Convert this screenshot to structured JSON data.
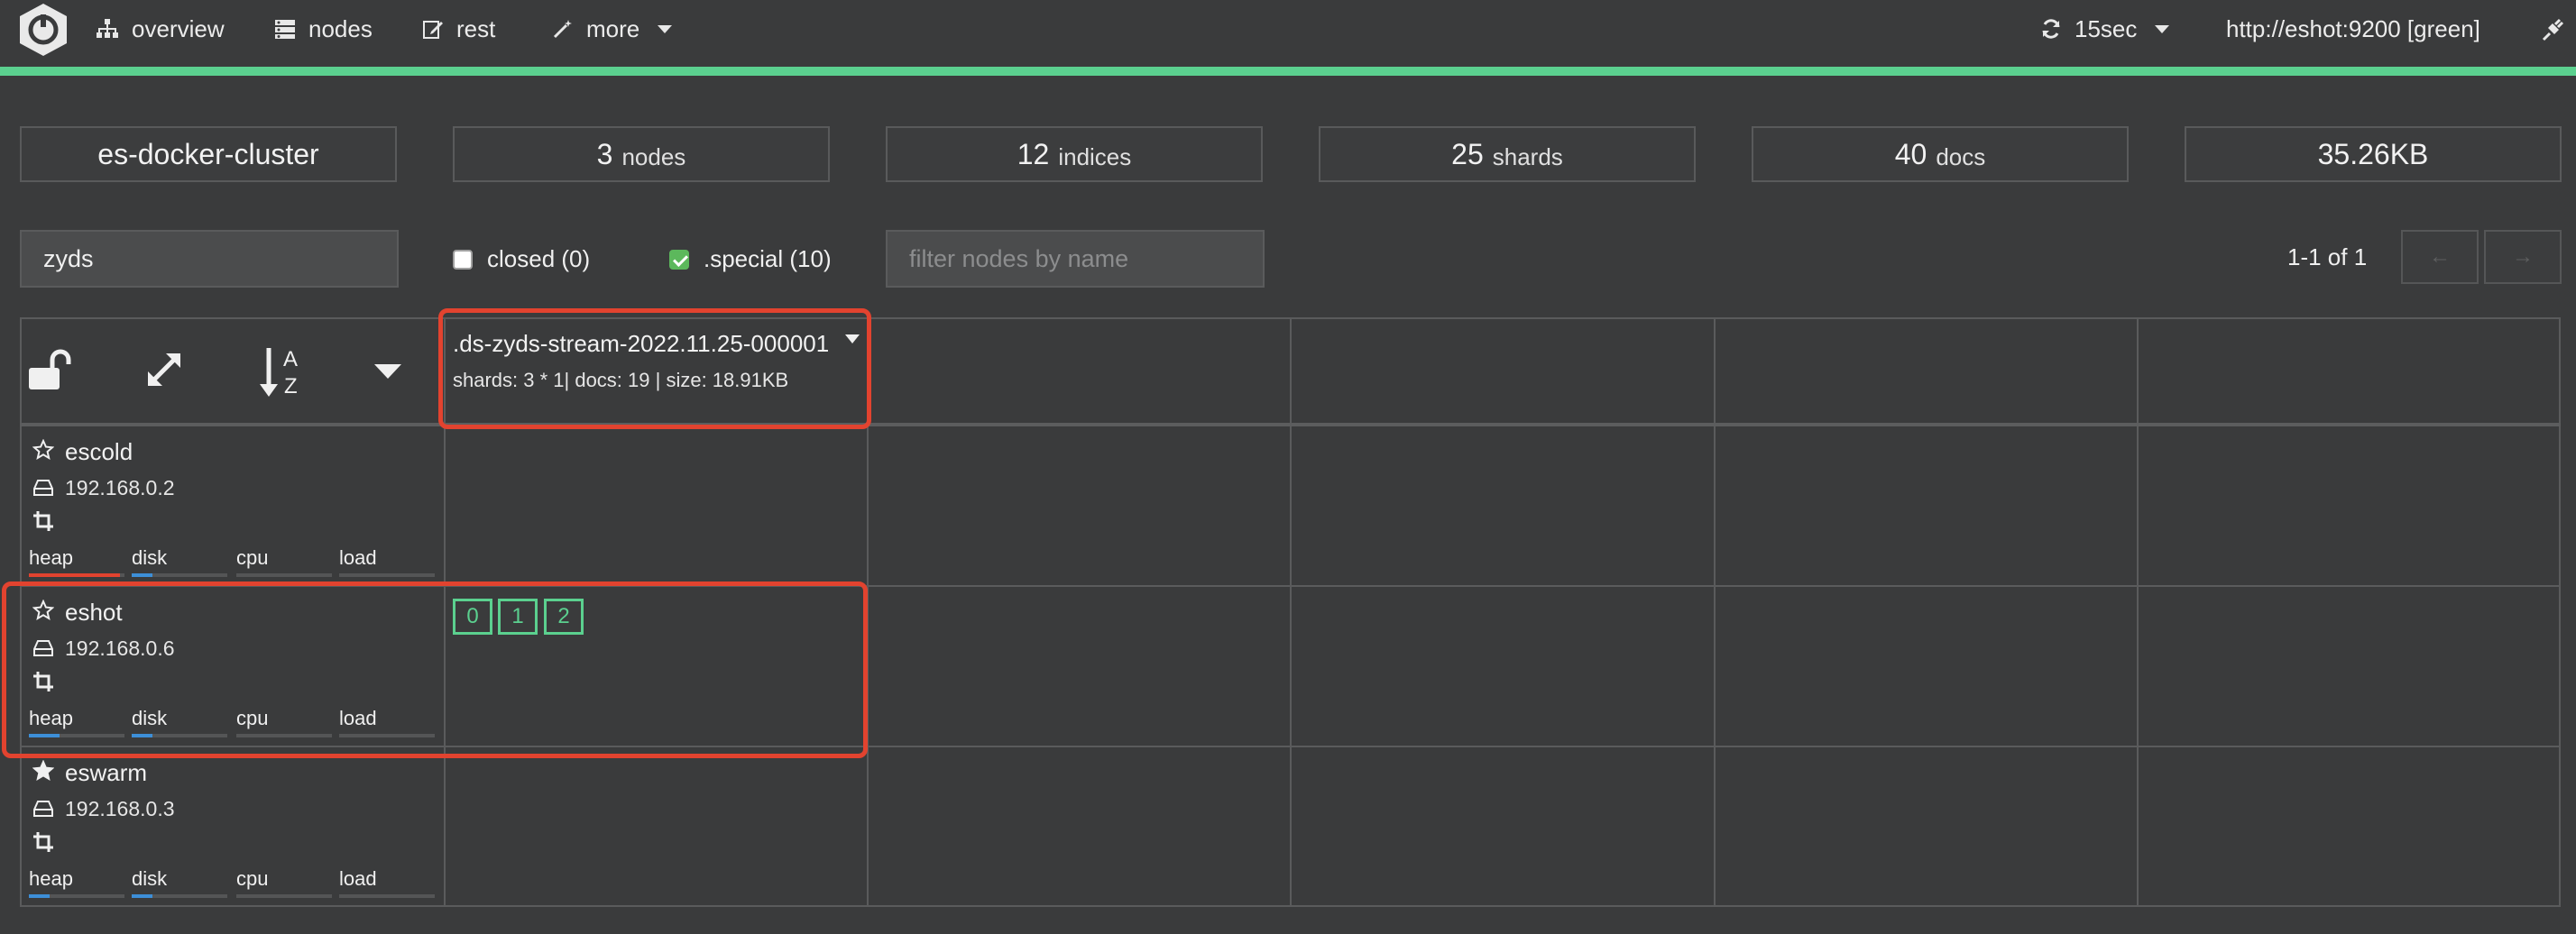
{
  "nav": {
    "overview": "overview",
    "nodes": "nodes",
    "rest": "rest",
    "more": "more",
    "refresh": "15sec",
    "connection": "http://eshot:9200 [green]"
  },
  "stats": {
    "cluster": "es-docker-cluster",
    "nodes_count": "3",
    "nodes_label": "nodes",
    "indices_count": "12",
    "indices_label": "indices",
    "shards_count": "25",
    "shards_label": "shards",
    "docs_count": "40",
    "docs_label": "docs",
    "size": "35.26KB"
  },
  "filters": {
    "index_filter_value": "zyds",
    "closed_label": "closed (0)",
    "closed_checked": false,
    "special_label": ".special (10)",
    "special_checked": true,
    "node_filter_placeholder": "filter nodes by name",
    "pagination": "1-1 of 1",
    "prev": "←",
    "next": "→"
  },
  "index": {
    "name": ".ds-zyds-stream-2022.11.25-000001",
    "meta": "shards: 3 * 1| docs: 19 | size: 18.91KB"
  },
  "metric_labels": {
    "heap": "heap",
    "disk": "disk",
    "cpu": "cpu",
    "load": "load"
  },
  "nodes": [
    {
      "name": "escold",
      "ip": "192.168.0.2",
      "master": false,
      "heap_pct": 0.95,
      "disk_pct": 0.22
    },
    {
      "name": "eshot",
      "ip": "192.168.0.6",
      "master": false,
      "heap_pct": 0.32,
      "disk_pct": 0.22,
      "shards": [
        "0",
        "1",
        "2"
      ]
    },
    {
      "name": "eswarm",
      "ip": "192.168.0.3",
      "master": true,
      "heap_pct": 0.22,
      "disk_pct": 0.22
    }
  ],
  "colors": {
    "accent": "#5bd08f",
    "heap_high": "#e2432f",
    "bar_fill": "#3d8fd8",
    "highlight": "#e2432f"
  }
}
